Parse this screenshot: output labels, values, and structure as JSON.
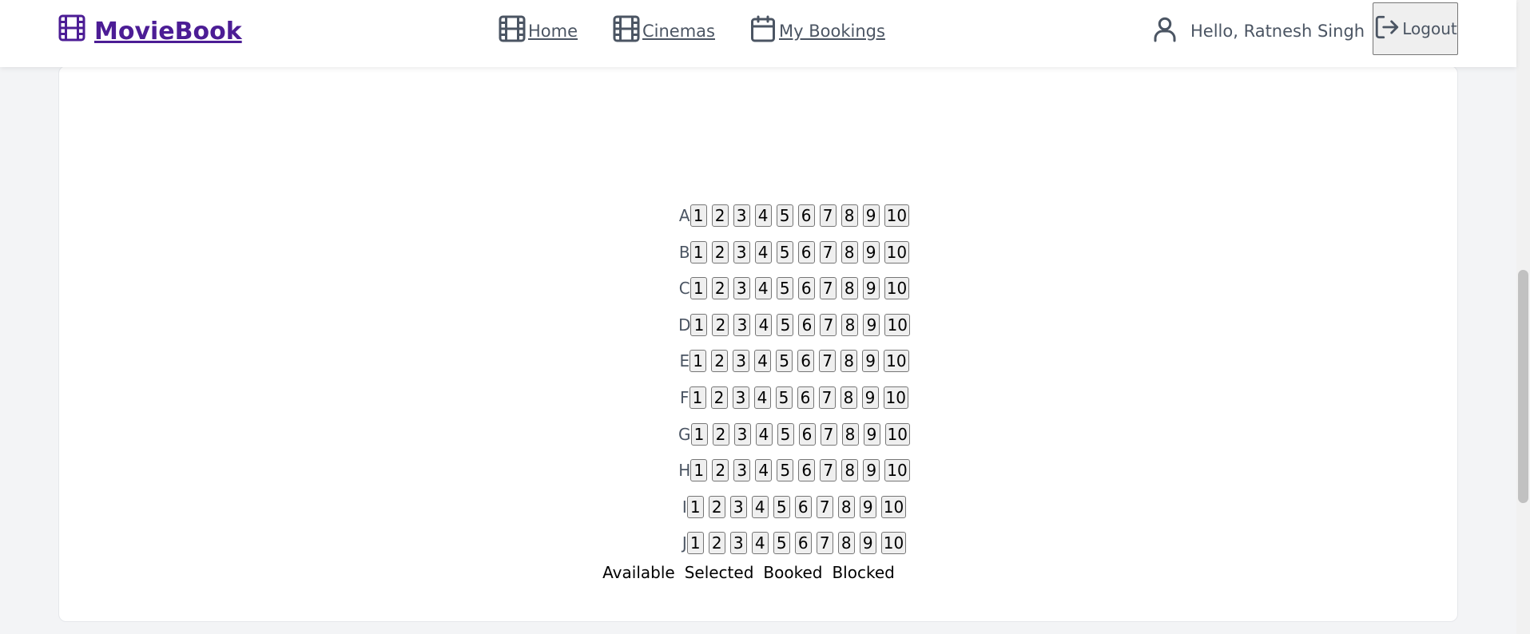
{
  "header": {
    "brand": "MovieBook",
    "nav": [
      {
        "label": "Home",
        "icon": "film-icon"
      },
      {
        "label": "Cinemas",
        "icon": "film-icon"
      },
      {
        "label": "My Bookings",
        "icon": "calendar-icon"
      }
    ],
    "greeting": "Hello, Ratnesh Singh",
    "logout_label": "Logout"
  },
  "seat_map": {
    "rows": [
      "A",
      "B",
      "C",
      "D",
      "E",
      "F",
      "G",
      "H",
      "I",
      "J"
    ],
    "seats": [
      "1",
      "2",
      "3",
      "4",
      "5",
      "6",
      "7",
      "8",
      "9",
      "10"
    ]
  },
  "legend": [
    "Available",
    "Selected",
    "Booked",
    "Blocked"
  ],
  "colors": {
    "brand": "#4c1d95",
    "text": "#4b5563",
    "seat_bg": "#efefef",
    "page_bg": "#f3f4f6"
  }
}
